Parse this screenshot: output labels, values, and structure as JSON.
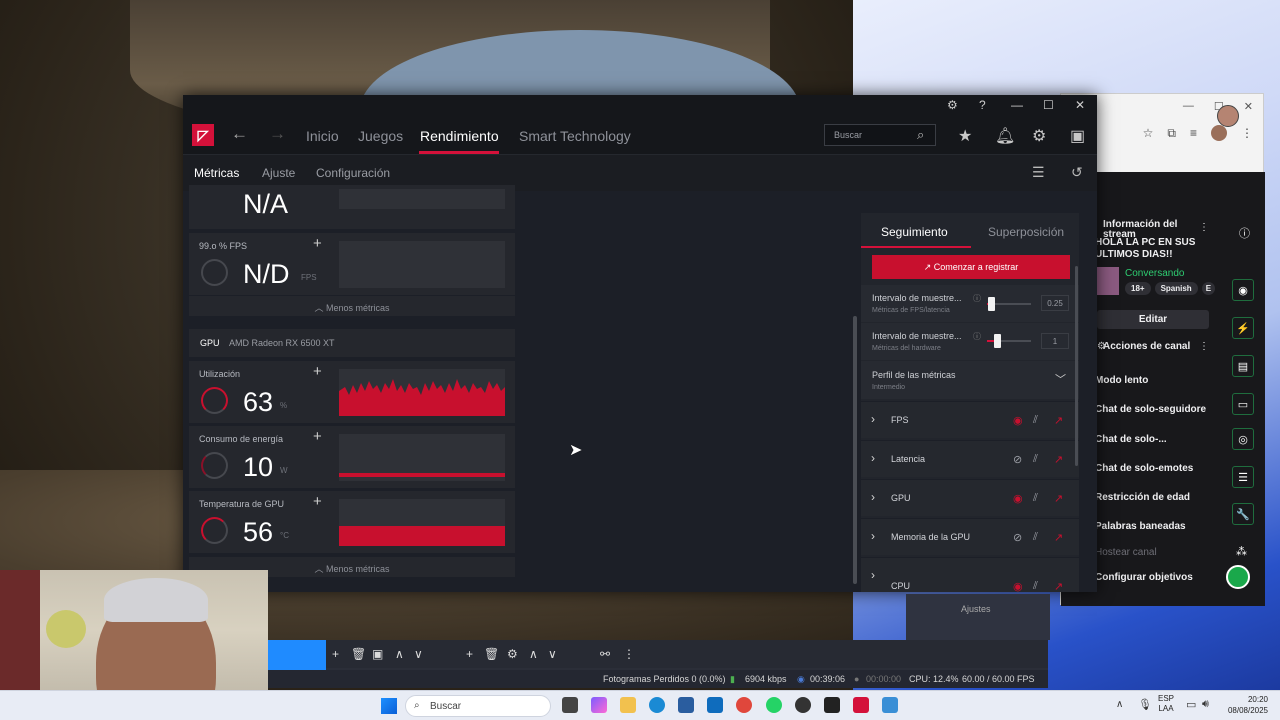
{
  "amd": {
    "nav": {
      "back": "←",
      "forward": "→",
      "tabs": [
        "Inicio",
        "Juegos",
        "Rendimiento",
        "Smart Technology"
      ],
      "search_placeholder": "Buscar"
    },
    "subtabs": [
      "Métricas",
      "Ajuste",
      "Configuración"
    ],
    "metrics_top": {
      "partial_value": "N/A",
      "fps_card": {
        "title": "99.o % FPS",
        "value": "N/D",
        "unit": "FPS"
      },
      "less_metrics": "Menos métricas"
    },
    "gpu": {
      "label": "GPU",
      "model": "AMD Radeon RX 6500 XT",
      "cards": [
        {
          "title": "Utilización",
          "value": "63",
          "unit": "%"
        },
        {
          "title": "Consumo de energía",
          "value": "10",
          "unit": "W"
        },
        {
          "title": "Temperatura de GPU",
          "value": "56",
          "unit": "°C"
        }
      ],
      "less_metrics": "Menos métricas"
    },
    "tracking": {
      "tabs": [
        "Seguimiento",
        "Superposición"
      ],
      "record_button": "Comenzar a registrar",
      "interval_fps": {
        "label": "Intervalo de muestre...",
        "sub": "Métricas de FPS/latencia",
        "value": "0.25",
        "level": 0.1
      },
      "interval_hw": {
        "label": "Intervalo de muestre...",
        "sub": "Métricas del hardware",
        "value": "1",
        "level": 0.22
      },
      "profile": {
        "label": "Perfil de las métricas",
        "value": "Intermedio"
      },
      "metrics": [
        {
          "name": "FPS",
          "visible": true
        },
        {
          "name": "Latencia",
          "visible": false
        },
        {
          "name": "GPU",
          "visible": true
        },
        {
          "name": "Memoria de la GPU",
          "visible": false
        },
        {
          "name": "CPU",
          "visible": true
        }
      ]
    }
  },
  "stream": {
    "info_title": "Información del stream",
    "stream_title_line1": "HOLA LA PC EN SUS",
    "stream_title_line2": "ULTIMOS DIAS!!",
    "category": "Conversando",
    "tags": [
      "18+",
      "Spanish",
      "E"
    ],
    "edit_button": "Editar",
    "actions_title": "Acciones de canal",
    "actions": [
      {
        "label": "Modo lento",
        "control": "arrow"
      },
      {
        "label": "Chat de solo-seguidore",
        "control": "arrow"
      },
      {
        "label": "Chat de solo-...",
        "control": "toggle"
      },
      {
        "label": "Chat de solo-emotes",
        "control": "toggle"
      },
      {
        "label": "Restricción de edad",
        "control": "arrow"
      },
      {
        "label": "Palabras baneadas",
        "control": "arrow"
      },
      {
        "label": "Hostear canal",
        "control": "none"
      },
      {
        "label": "Configurar objetivos",
        "control": "arrow"
      }
    ]
  },
  "obs": {
    "adjust": "Ajustes",
    "dropped": "Fotogramas Perdidos 0 (0.0%)",
    "bitrate": "6904 kbps",
    "live_time": "00:39:06",
    "rec_time": "00:00:00",
    "cpu": "CPU: 12.4%",
    "fps": "60.00 / 60.00 FPS"
  },
  "taskbar": {
    "search": "Buscar",
    "lang1": "ESP",
    "lang2": "LAA",
    "time": "20:20",
    "date": "08/08/2025"
  },
  "colors": {
    "amd_red": "#c8102e",
    "twitch_green": "#1f6d3e"
  }
}
